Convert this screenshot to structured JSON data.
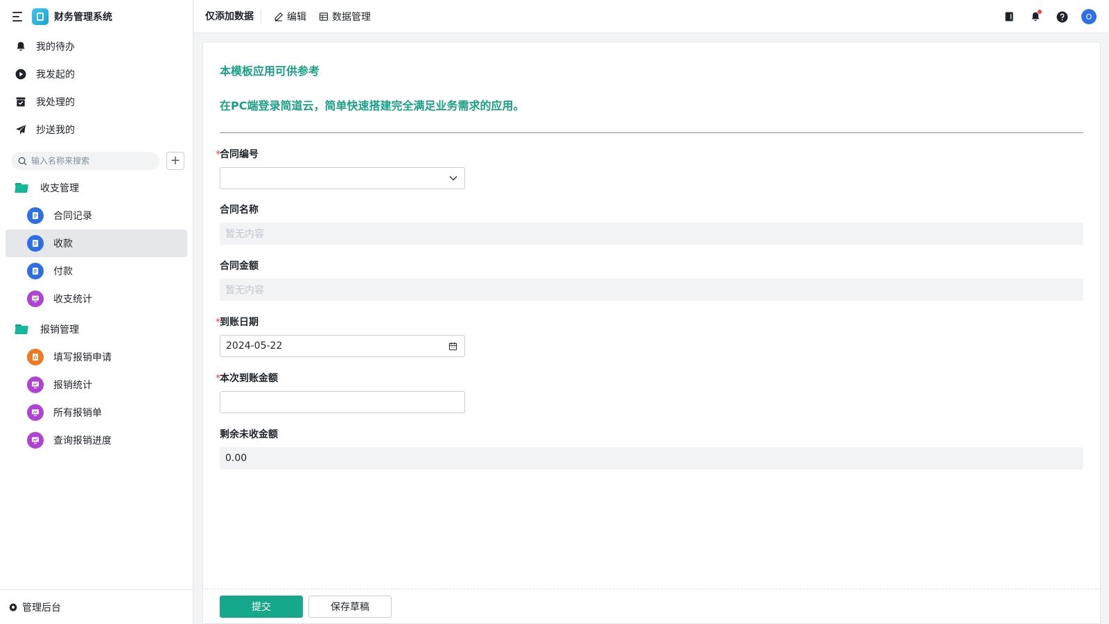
{
  "app": {
    "title": "财务管理系统"
  },
  "quick_nav": [
    {
      "label": "我的待办",
      "icon": "bell-icon"
    },
    {
      "label": "我发起的",
      "icon": "play-icon"
    },
    {
      "label": "我处理的",
      "icon": "inbox-check-icon"
    },
    {
      "label": "抄送我的",
      "icon": "send-icon"
    }
  ],
  "search": {
    "placeholder": "输入名称来搜索"
  },
  "groups": [
    {
      "label": "收支管理",
      "items": [
        {
          "label": "合同记录",
          "icon": "form-icon",
          "color": "#2f6fe6"
        },
        {
          "label": "收款",
          "icon": "form-icon",
          "color": "#2f6fe6",
          "active": true
        },
        {
          "label": "付款",
          "icon": "form-icon",
          "color": "#2f6fe6"
        },
        {
          "label": "收支统计",
          "icon": "dashboard-icon",
          "color": "#b042d6"
        }
      ]
    },
    {
      "label": "报销管理",
      "items": [
        {
          "label": "填写报销申请",
          "icon": "warning-form-icon",
          "color": "#f07a24"
        },
        {
          "label": "报销统计",
          "icon": "dashboard-icon",
          "color": "#b042d6"
        },
        {
          "label": "所有报销单",
          "icon": "dashboard-icon",
          "color": "#b042d6"
        },
        {
          "label": "查询报销进度",
          "icon": "dashboard-icon",
          "color": "#b042d6"
        }
      ]
    }
  ],
  "footer": {
    "admin_label": "管理后台"
  },
  "topbar": {
    "title": "仅添加数据",
    "edit_label": "编辑",
    "data_mgmt_label": "数据管理",
    "avatar_initial": "O"
  },
  "form": {
    "description": [
      "本模板应用可供参考",
      "在PC端登录简道云，简单快速搭建完全满足业务需求的应用。"
    ],
    "fields": {
      "contract_no": {
        "label": "合同编号",
        "required": true,
        "value": ""
      },
      "contract_name": {
        "label": "合同名称",
        "value": "暂无内容"
      },
      "contract_amount": {
        "label": "合同金额",
        "value": "暂无内容"
      },
      "arrival_date": {
        "label": "到账日期",
        "required": true,
        "value": "2024-05-22"
      },
      "arrival_amount": {
        "label": "本次到账金额",
        "required": true,
        "value": ""
      },
      "remaining": {
        "label": "剩余未收金额",
        "value": "0.00"
      }
    },
    "submit_label": "提交",
    "draft_label": "保存草稿"
  },
  "colors": {
    "accent": "#16a88a",
    "required": "#f53f3f",
    "avatar": "#2f6fe6"
  }
}
